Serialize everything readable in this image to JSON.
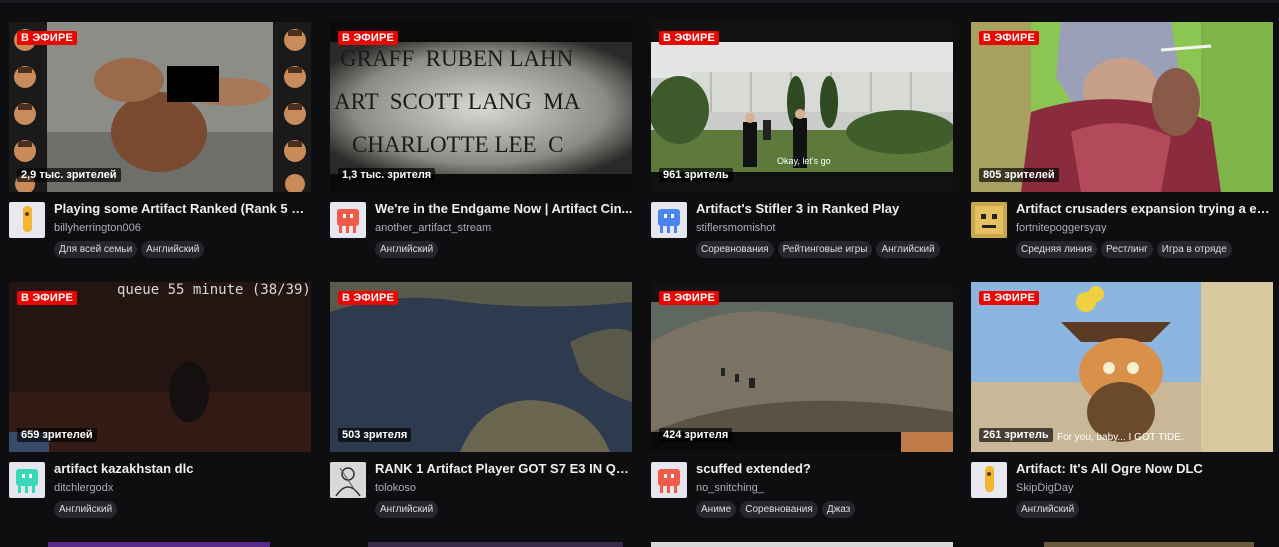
{
  "live_label": "В ЭФИРЕ",
  "streams": [
    {
      "viewers": "2,9 тыс. зрителей",
      "title": "Playing some Artifact Ranked (Rank 5 W...",
      "channel": "billyherrington006",
      "tags": [
        "Для всей семьи",
        "Английский"
      ],
      "avatar_icon": "yellow-character-icon"
    },
    {
      "viewers": "1,3 тыс. зрителя",
      "title": "We're in the Endgame Now | Artifact Cin...",
      "channel": "another_artifact_stream",
      "tags": [
        "Английский"
      ],
      "avatar_icon": "red-glitch-icon",
      "overlay_lines": [
        "GRAFF  RUBEN LAHN",
        "ART  SCOTT LANG  MA",
        "CHARLOTTE LEE  C"
      ]
    },
    {
      "viewers": "961 зритель",
      "title": "Artifact's Stifler 3 in Ranked Play",
      "channel": "stiflersmomishot",
      "tags": [
        "Соревнования",
        "Рейтинговые игры",
        "Английский"
      ],
      "avatar_icon": "blue-glitch-icon",
      "subtitle": "Okay, let's go"
    },
    {
      "viewers": "805 зрителей",
      "title": "Artifact crusaders expansion trying a eg...",
      "channel": "fortnitepoggersyay",
      "tags": [
        "Средняя линия",
        "Рестлинг",
        "Игра в отряде"
      ],
      "avatar_icon": "pixel-face-icon"
    },
    {
      "viewers": "659 зрителей",
      "title": "artifact kazakhstan dlc",
      "channel": "ditchlergodx",
      "tags": [
        "Английский"
      ],
      "avatar_icon": "teal-glitch-icon",
      "overlay_lines": [
        "queue 55 minute (38/39)"
      ]
    },
    {
      "viewers": "503 зрителя",
      "title": "RANK 1 Artifact Player GOT S7 E3 IN QU...",
      "channel": "tolokoso",
      "tags": [
        "Английский"
      ],
      "avatar_icon": "sketch-portrait-icon"
    },
    {
      "viewers": "424 зрителя",
      "title": "scuffed extended?",
      "channel": "no_snitching_",
      "tags": [
        "Аниме",
        "Соревнования",
        "Джаз"
      ],
      "avatar_icon": "red-glitch-icon"
    },
    {
      "viewers": "261 зритель",
      "title": "Artifact: It's All Ogre Now DLC",
      "channel": "SkipDigDay",
      "tags": [
        "Английский"
      ],
      "avatar_icon": "yellow-character-icon",
      "subtitle": "For you, baby... I GOT TIDE."
    }
  ]
}
